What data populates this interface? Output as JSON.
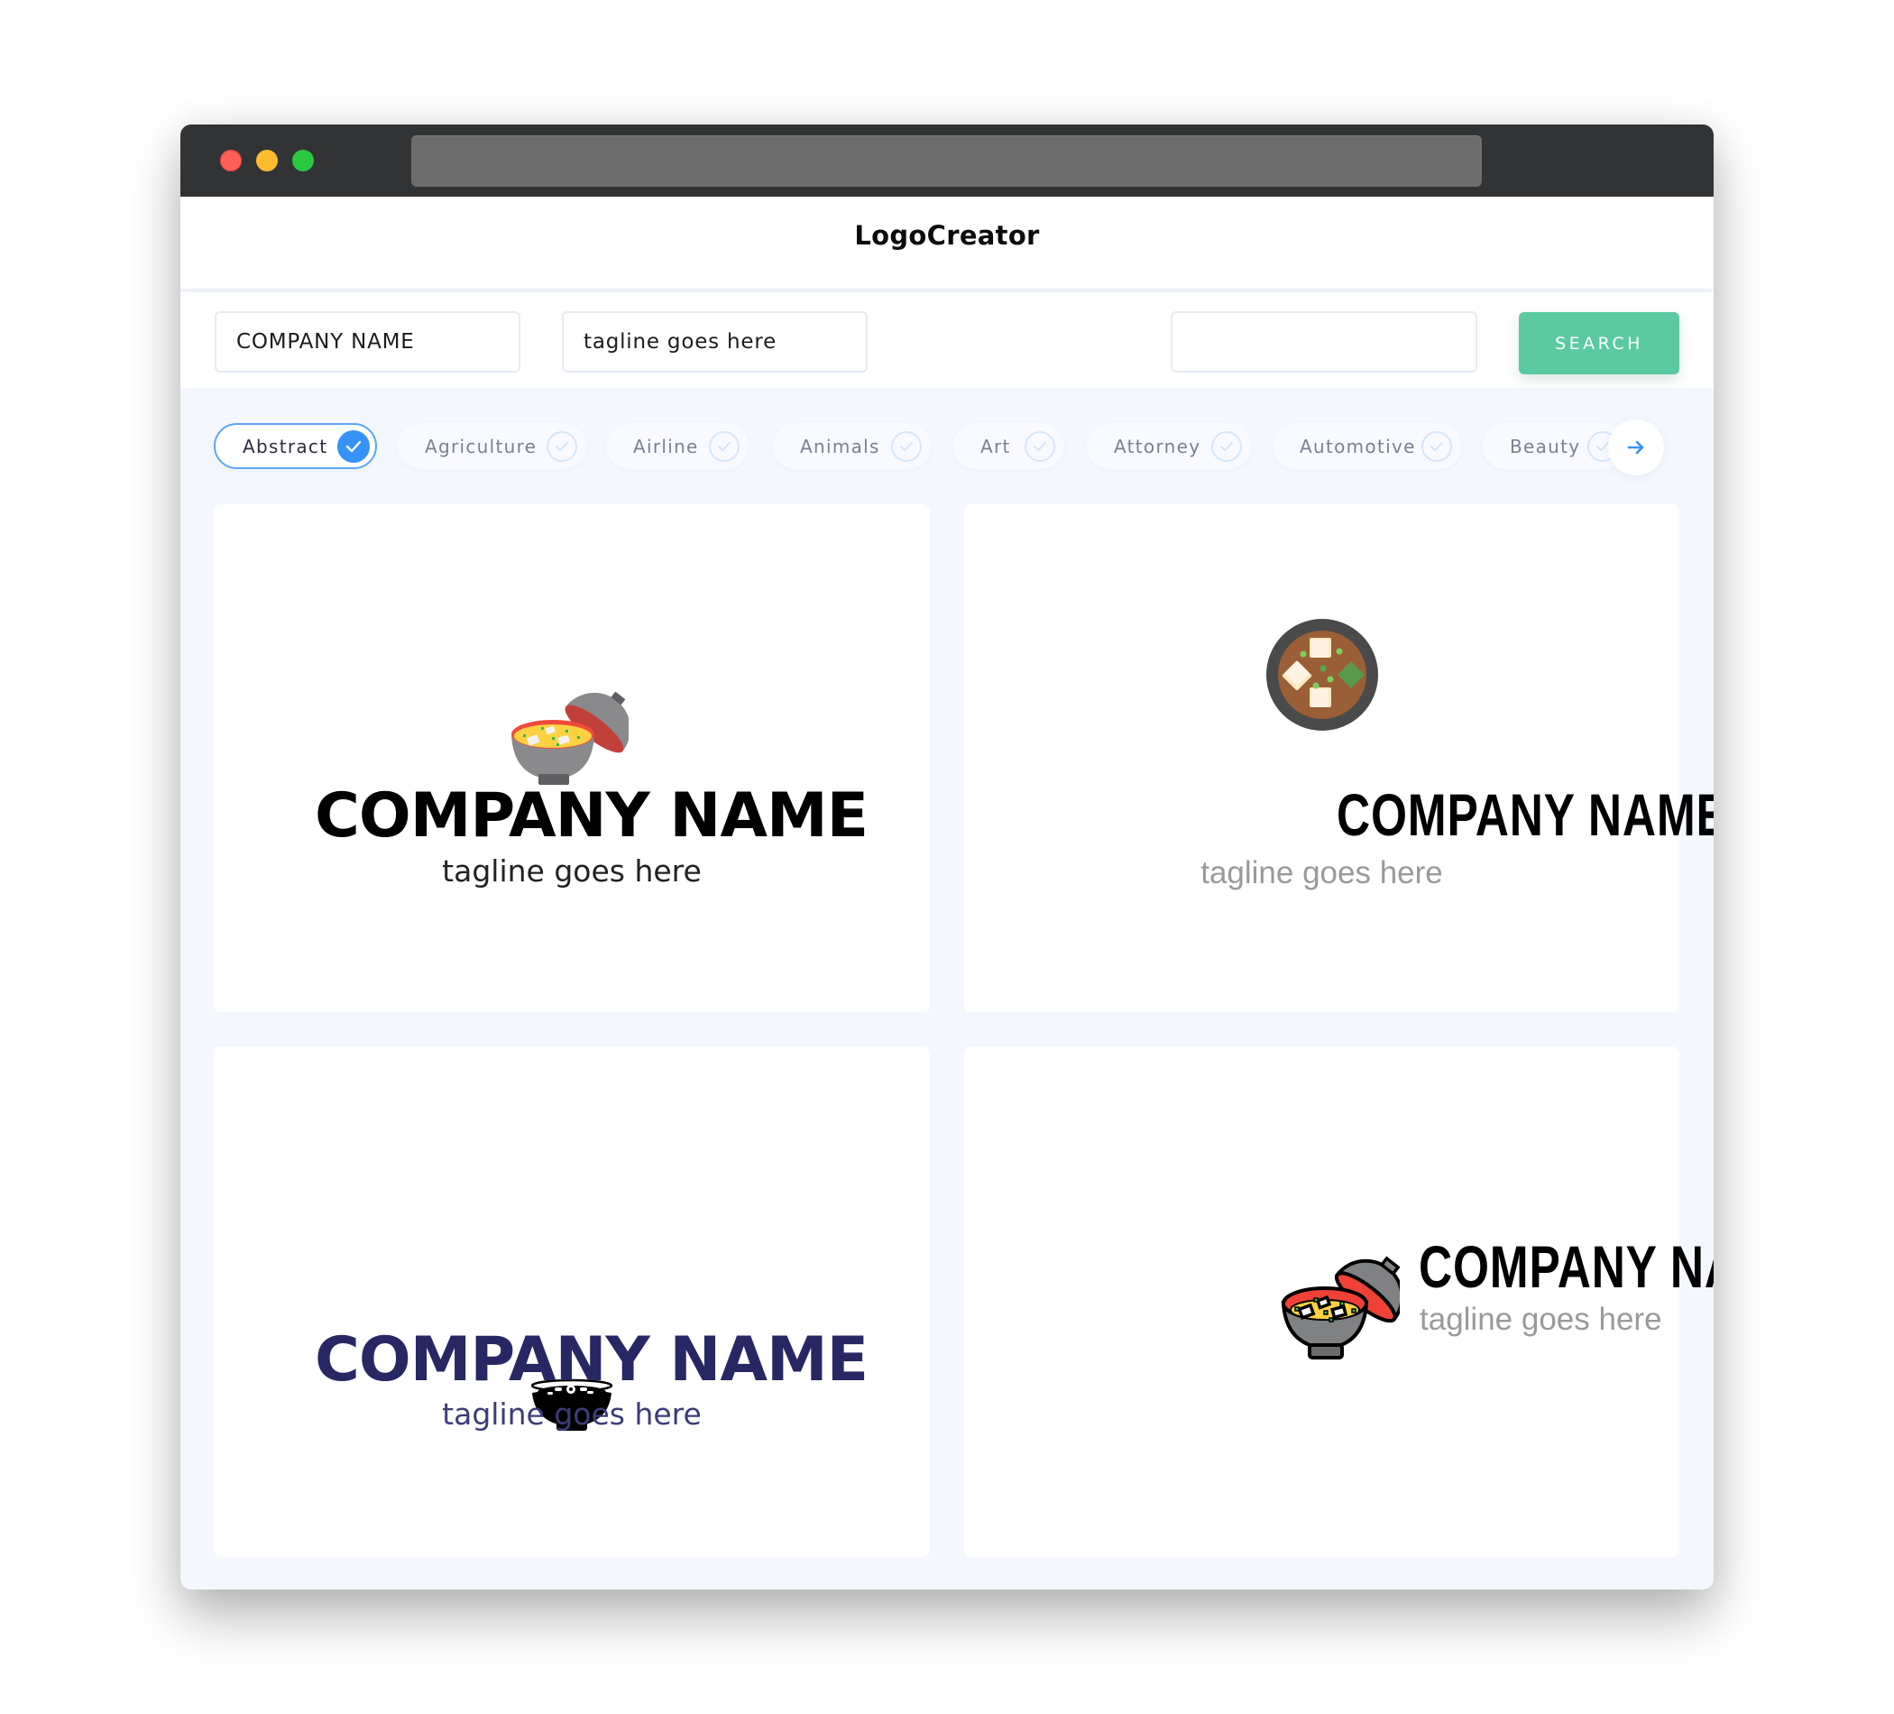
{
  "browser": {
    "window_controls": [
      "close",
      "minimize",
      "maximize"
    ],
    "address_bar_text": ""
  },
  "header": {
    "title": "LogoCreator"
  },
  "search_bar": {
    "company_name_value": "COMPANY NAME",
    "tagline_value": "tagline goes here",
    "keyword_value": "",
    "search_button_label": "SEARCH"
  },
  "categories": {
    "items": [
      {
        "label": "Abstract",
        "selected": true
      },
      {
        "label": "Agriculture",
        "selected": false
      },
      {
        "label": "Airline",
        "selected": false
      },
      {
        "label": "Animals",
        "selected": false
      },
      {
        "label": "Art",
        "selected": false
      },
      {
        "label": "Attorney",
        "selected": false
      },
      {
        "label": "Automotive",
        "selected": false
      },
      {
        "label": "Beauty",
        "selected": false
      }
    ],
    "next_icon": "arrow-right-icon",
    "accent_color": "#3792f5"
  },
  "logos": [
    {
      "company": "COMPANY NAME",
      "tagline": "tagline goes here",
      "icon": "miso-soup-bowl-open-lid-flat-icon",
      "title_color": "#000000",
      "tagline_color": "#222222"
    },
    {
      "company": "COMPANY NAME",
      "tagline": "tagline goes here",
      "icon": "miso-soup-top-view-icon",
      "title_color": "#000000",
      "tagline_color": "#9a9a9a"
    },
    {
      "company": "COMPANY NAME",
      "tagline": "tagline goes here",
      "icon": "soup-bowl-glyph-icon",
      "title_color": "#272863",
      "tagline_color": "#3c3d78"
    },
    {
      "company": "COMPANY NAME",
      "tagline": "tagline goes here",
      "icon": "miso-soup-bowl-outlined-icon",
      "title_color": "#000000",
      "tagline_color": "#9a9a9a"
    }
  ],
  "colors": {
    "search_button": "#5bc9a1",
    "titlebar": "#323335",
    "page_background": "#f4f7fd"
  }
}
